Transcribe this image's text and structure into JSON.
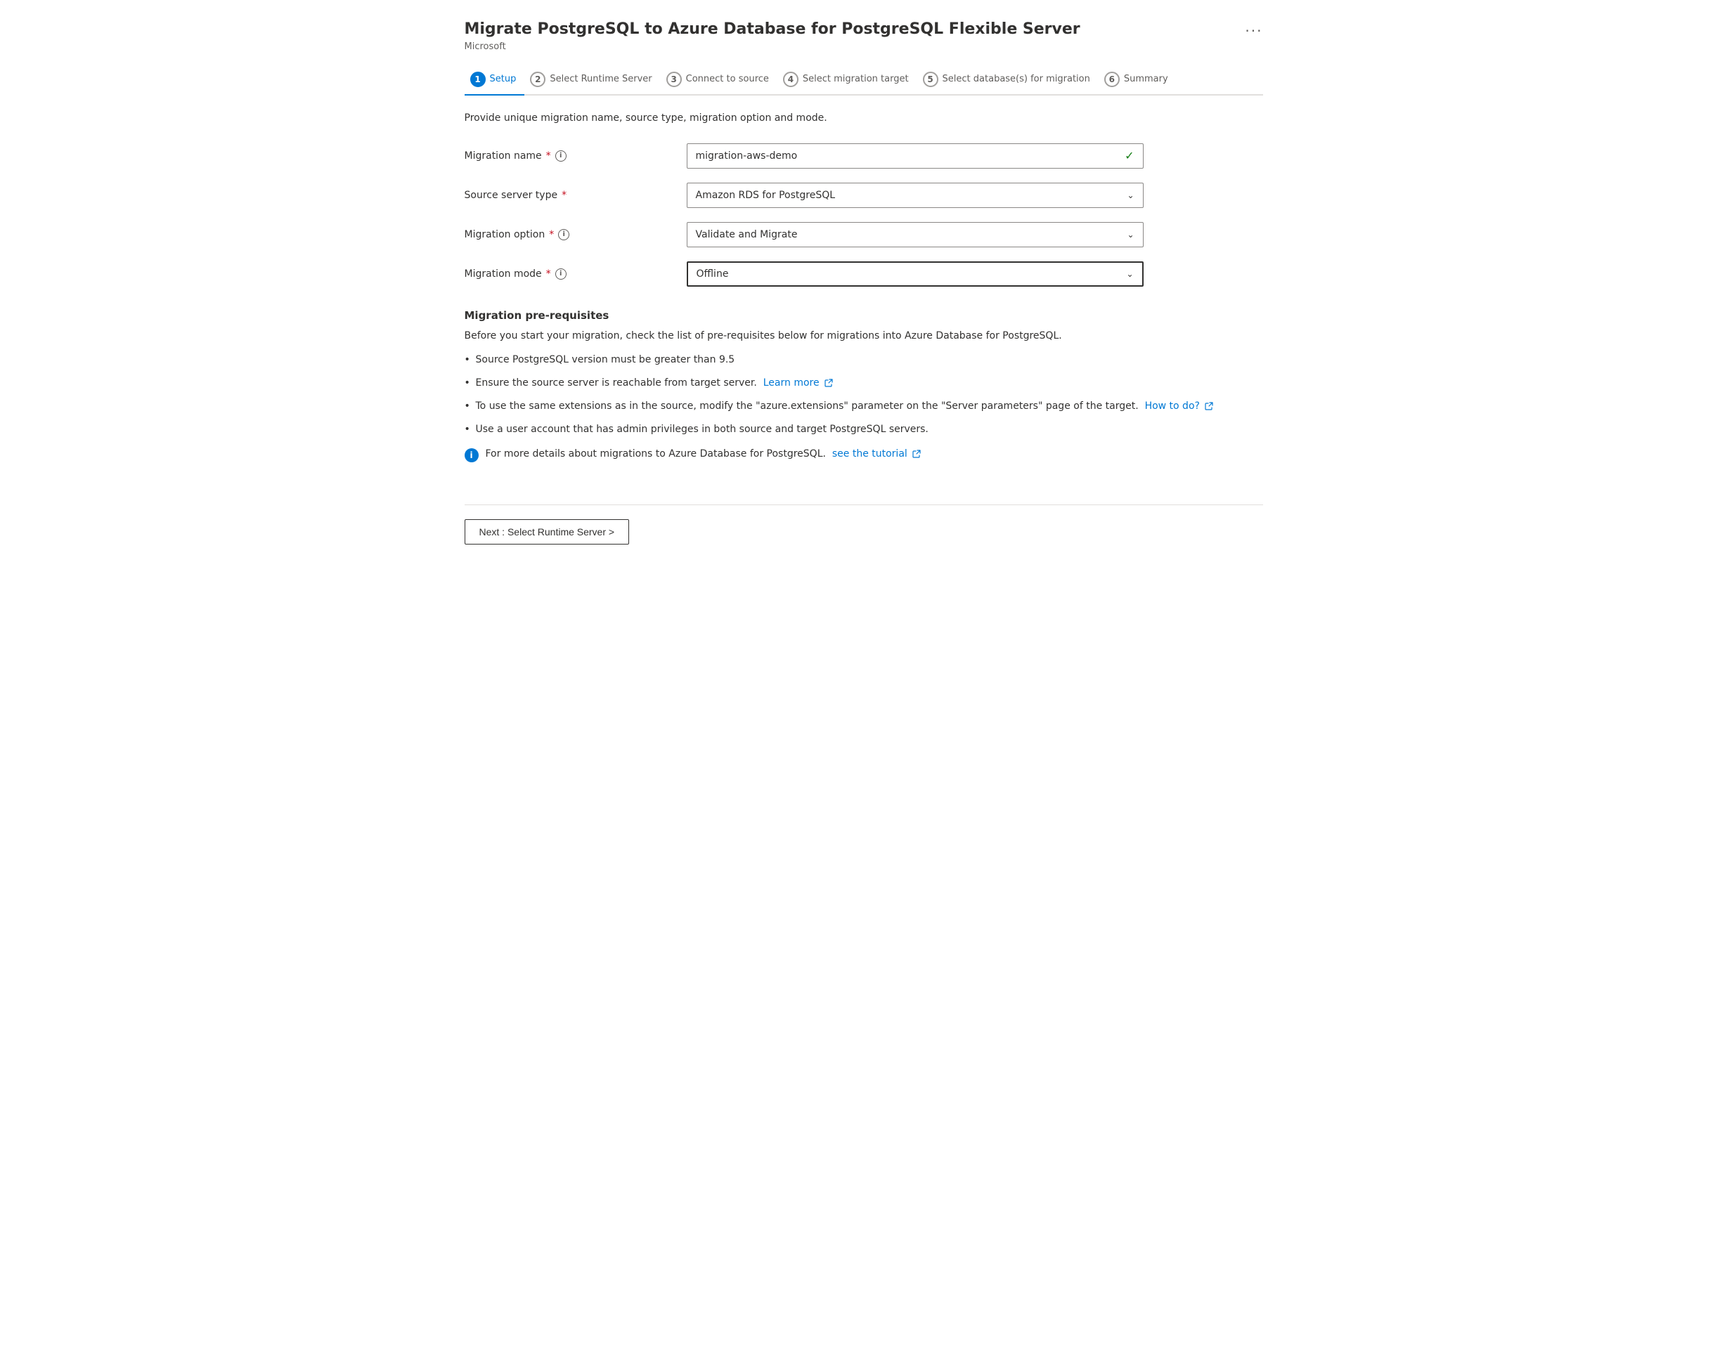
{
  "header": {
    "title": "Migrate PostgreSQL to Azure Database for PostgreSQL Flexible Server",
    "subtitle": "Microsoft",
    "more_icon": "···"
  },
  "steps": [
    {
      "number": "1",
      "label": "Setup",
      "active": true
    },
    {
      "number": "2",
      "label": "Select Runtime Server",
      "active": false
    },
    {
      "number": "3",
      "label": "Connect to source",
      "active": false
    },
    {
      "number": "4",
      "label": "Select migration target",
      "active": false
    },
    {
      "number": "5",
      "label": "Select database(s) for migration",
      "active": false
    },
    {
      "number": "6",
      "label": "Summary",
      "active": false
    }
  ],
  "page_description": "Provide unique migration name, source type, migration option and mode.",
  "form": {
    "migration_name_label": "Migration name",
    "migration_name_required": "*",
    "migration_name_value": "migration-aws-demo",
    "source_server_type_label": "Source server type",
    "source_server_type_required": "*",
    "source_server_type_value": "Amazon RDS for PostgreSQL",
    "migration_option_label": "Migration option",
    "migration_option_required": "*",
    "migration_option_value": "Validate and Migrate",
    "migration_mode_label": "Migration mode",
    "migration_mode_required": "*",
    "migration_mode_value": "Offline"
  },
  "prerequisites": {
    "title": "Migration pre-requisites",
    "description": "Before you start your migration, check the list of pre-requisites below for migrations into Azure Database for PostgreSQL.",
    "items": [
      {
        "text": "Source PostgreSQL version must be greater than 9.5",
        "link_text": null,
        "link_href": null
      },
      {
        "text": "Ensure the source server is reachable from target server.",
        "link_text": "Learn more",
        "link_href": "#"
      },
      {
        "text": "To use the same extensions as in the source, modify the \"azure.extensions\" parameter on the \"Server parameters\" page of the target.",
        "link_text": "How to do?",
        "link_href": "#"
      },
      {
        "text": "Use a user account that has admin privileges in both source and target PostgreSQL servers.",
        "link_text": null,
        "link_href": null
      }
    ],
    "info_text": "For more details about migrations to Azure Database for PostgreSQL.",
    "info_link_text": "see the tutorial",
    "info_link_href": "#"
  },
  "footer": {
    "next_button_label": "Next : Select Runtime Server >"
  }
}
